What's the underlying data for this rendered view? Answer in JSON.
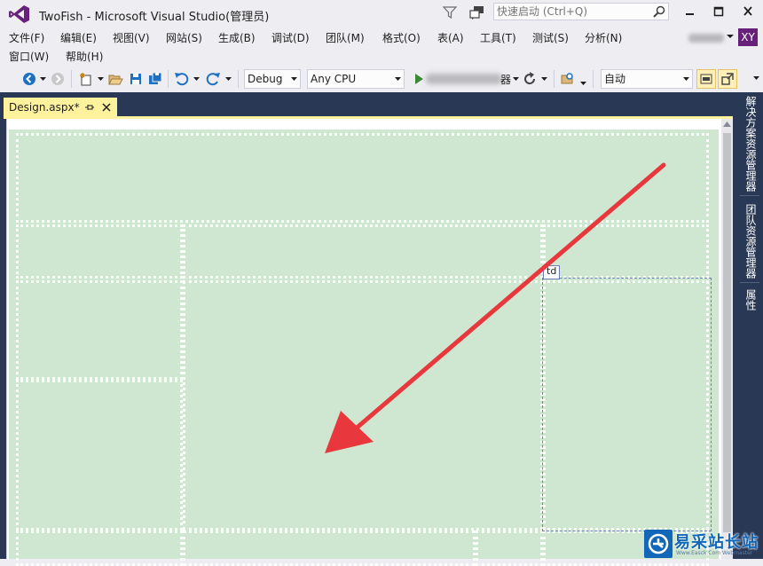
{
  "window": {
    "title": "TwoFish - Microsoft Visual Studio(管理员)",
    "quick_launch_placeholder": "快速启动 (Ctrl+Q)",
    "user_initials": "XY"
  },
  "menus": {
    "row1": [
      "文件(F)",
      "编辑(E)",
      "视图(V)",
      "网站(S)",
      "生成(B)",
      "调试(D)",
      "团队(M)",
      "格式(O)",
      "表(A)",
      "工具(T)",
      "测试(S)",
      "分析(N)"
    ],
    "row2": [
      "窗口(W)",
      "帮助(H)"
    ]
  },
  "toolbar": {
    "config": "Debug",
    "platform": "Any CPU",
    "run_suffix": "器",
    "style_target": "自动"
  },
  "document": {
    "tab_label": "Design.aspx*",
    "selected_tag": "td"
  },
  "side_panels": [
    "解决方案资源管理器",
    "团队资源管理器",
    "属性"
  ],
  "watermark": {
    "brand": "易采站长站",
    "sub": "Www.Easck.Com Webmaster"
  },
  "colors": {
    "accent": "#68217a",
    "tab_active": "#fff29d",
    "navy": "#293955",
    "canvas_green": "#cfe7d1",
    "annotation_arrow": "#e8383d"
  }
}
